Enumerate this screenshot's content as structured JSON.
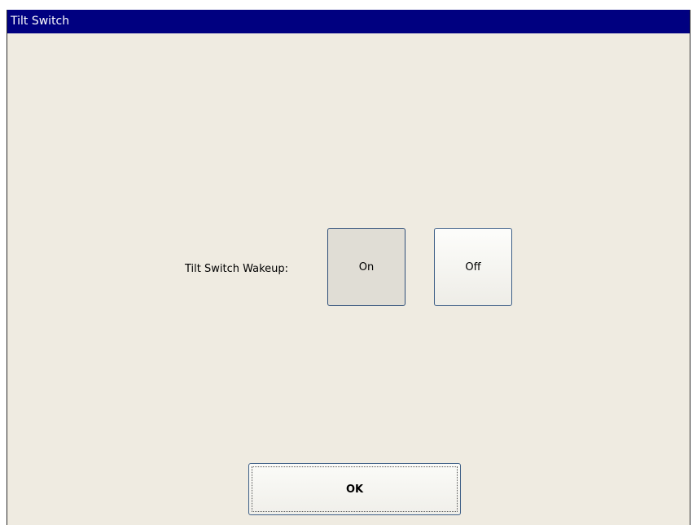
{
  "window": {
    "title": "Tilt Switch"
  },
  "setting": {
    "label": "Tilt Switch Wakeup:",
    "options": [
      {
        "label": "On",
        "selected": true
      },
      {
        "label": "Off",
        "selected": false
      }
    ]
  },
  "footer": {
    "ok_label": "OK"
  },
  "colors": {
    "titlebar": "#000080",
    "background": "#efebe1",
    "button_border": "#3e5f87"
  }
}
